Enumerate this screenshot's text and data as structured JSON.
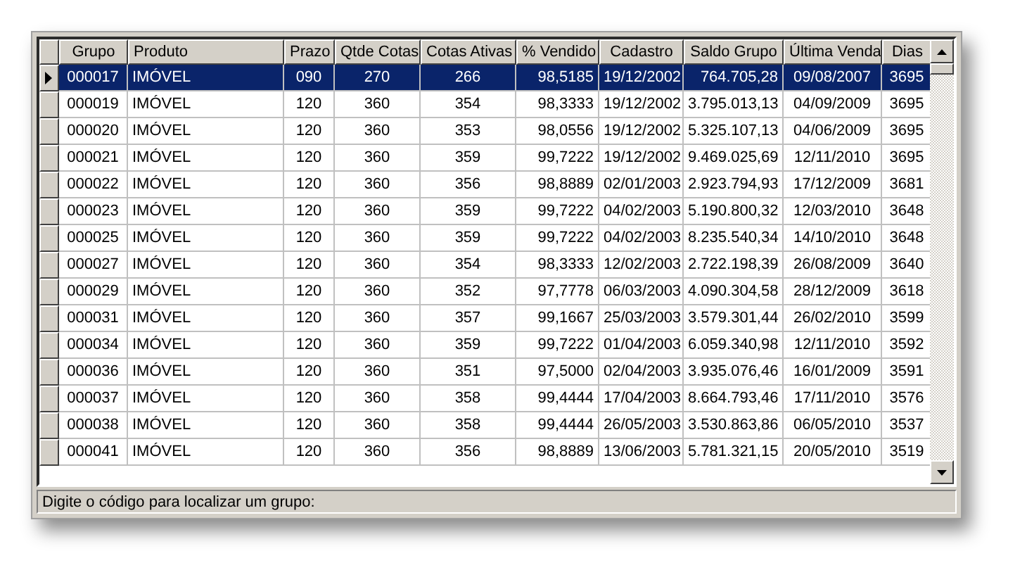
{
  "table": {
    "columns": [
      "Grupo",
      "Produto",
      "Prazo",
      "Qtde Cotas",
      "Cotas Ativas",
      "% Vendido",
      "Cadastro",
      "Saldo Grupo",
      "Última Venda",
      "Dias"
    ],
    "rows": [
      {
        "selected": true,
        "cells": [
          "000017",
          "IMÓVEL",
          "090",
          "270",
          "266",
          "98,5185",
          "19/12/2002",
          "764.705,28",
          "09/08/2007",
          "3695"
        ]
      },
      {
        "selected": false,
        "cells": [
          "000019",
          "IMÓVEL",
          "120",
          "360",
          "354",
          "98,3333",
          "19/12/2002",
          "3.795.013,13",
          "04/09/2009",
          "3695"
        ]
      },
      {
        "selected": false,
        "cells": [
          "000020",
          "IMÓVEL",
          "120",
          "360",
          "353",
          "98,0556",
          "19/12/2002",
          "5.325.107,13",
          "04/06/2009",
          "3695"
        ]
      },
      {
        "selected": false,
        "cells": [
          "000021",
          "IMÓVEL",
          "120",
          "360",
          "359",
          "99,7222",
          "19/12/2002",
          "9.469.025,69",
          "12/11/2010",
          "3695"
        ]
      },
      {
        "selected": false,
        "cells": [
          "000022",
          "IMÓVEL",
          "120",
          "360",
          "356",
          "98,8889",
          "02/01/2003",
          "2.923.794,93",
          "17/12/2009",
          "3681"
        ]
      },
      {
        "selected": false,
        "cells": [
          "000023",
          "IMÓVEL",
          "120",
          "360",
          "359",
          "99,7222",
          "04/02/2003",
          "5.190.800,32",
          "12/03/2010",
          "3648"
        ]
      },
      {
        "selected": false,
        "cells": [
          "000025",
          "IMÓVEL",
          "120",
          "360",
          "359",
          "99,7222",
          "04/02/2003",
          "8.235.540,34",
          "14/10/2010",
          "3648"
        ]
      },
      {
        "selected": false,
        "cells": [
          "000027",
          "IMÓVEL",
          "120",
          "360",
          "354",
          "98,3333",
          "12/02/2003",
          "2.722.198,39",
          "26/08/2009",
          "3640"
        ]
      },
      {
        "selected": false,
        "cells": [
          "000029",
          "IMÓVEL",
          "120",
          "360",
          "352",
          "97,7778",
          "06/03/2003",
          "4.090.304,58",
          "28/12/2009",
          "3618"
        ]
      },
      {
        "selected": false,
        "cells": [
          "000031",
          "IMÓVEL",
          "120",
          "360",
          "357",
          "99,1667",
          "25/03/2003",
          "3.579.301,44",
          "26/02/2010",
          "3599"
        ]
      },
      {
        "selected": false,
        "cells": [
          "000034",
          "IMÓVEL",
          "120",
          "360",
          "359",
          "99,7222",
          "01/04/2003",
          "6.059.340,98",
          "12/11/2010",
          "3592"
        ]
      },
      {
        "selected": false,
        "cells": [
          "000036",
          "IMÓVEL",
          "120",
          "360",
          "351",
          "97,5000",
          "02/04/2003",
          "3.935.076,46",
          "16/01/2009",
          "3591"
        ]
      },
      {
        "selected": false,
        "cells": [
          "000037",
          "IMÓVEL",
          "120",
          "360",
          "358",
          "99,4444",
          "17/04/2003",
          "8.664.793,46",
          "17/11/2010",
          "3576"
        ]
      },
      {
        "selected": false,
        "cells": [
          "000038",
          "IMÓVEL",
          "120",
          "360",
          "358",
          "99,4444",
          "26/05/2003",
          "3.530.863,86",
          "06/05/2010",
          "3537"
        ]
      },
      {
        "selected": false,
        "cells": [
          "000041",
          "IMÓVEL",
          "120",
          "360",
          "356",
          "98,8889",
          "13/06/2003",
          "5.781.321,15",
          "20/05/2010",
          "3519"
        ]
      }
    ]
  },
  "status_bar": "Digite o código para localizar um grupo:"
}
